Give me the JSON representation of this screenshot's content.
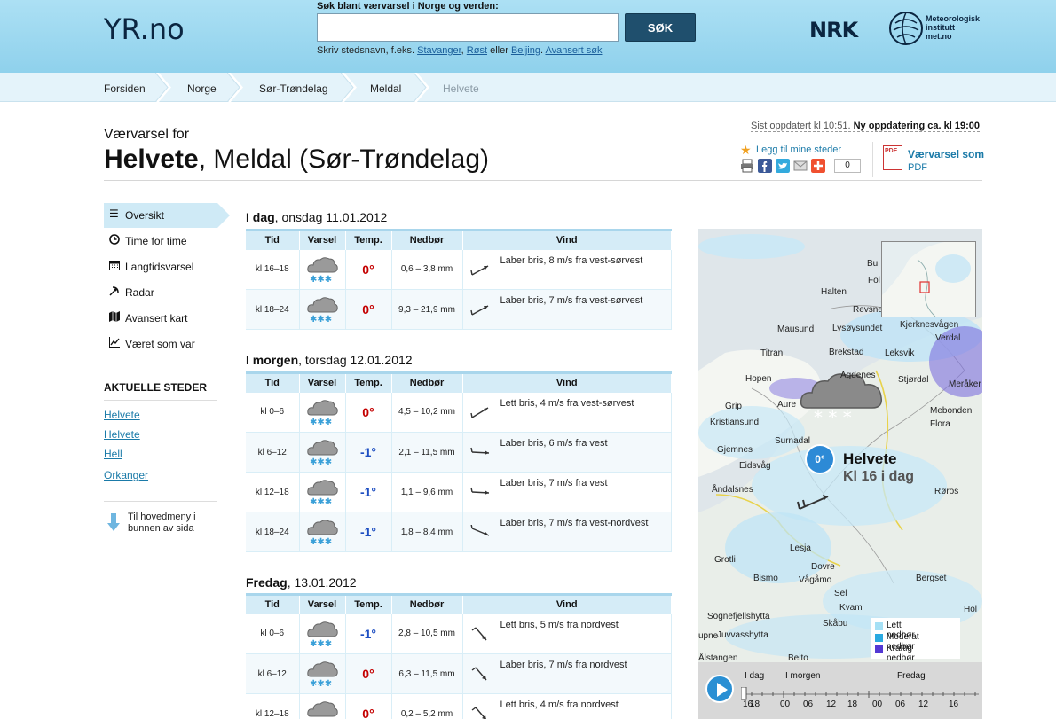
{
  "header": {
    "logo": "YR.no",
    "search_label": "Søk blant værvarsel i Norge og verden:",
    "search_value": "",
    "search_button": "SØK",
    "hint_prefix": "Skriv stedsnavn, f.eks.",
    "hint_links": [
      "Stavanger",
      "Røst",
      "Beijing"
    ],
    "hint_sep1": ",",
    "hint_sep2": "eller",
    "hint_advanced": "Avansert søk",
    "nrk": "NRK",
    "met_lines": [
      "Meteorologisk",
      "institutt",
      "met.no"
    ]
  },
  "breadcrumb": [
    "Forsiden",
    "Norge",
    "Sør-Trøndelag",
    "Meldal",
    "Helvete"
  ],
  "title": {
    "sub": "Værvarsel for",
    "place": "Helvete",
    "rest": ", Meldal (Sør-Trøndelag)"
  },
  "updated": {
    "last": "Sist oppdatert kl 10:51.",
    "next": "Ny oppdatering ca. kl 19:00"
  },
  "actions": {
    "favorite": "Legg til mine steder",
    "share_count": "0",
    "pdf_label": "Værvarsel som",
    "pdf_sub": "PDF"
  },
  "sidebar": {
    "items": [
      {
        "label": "Oversikt",
        "icon": "list-icon"
      },
      {
        "label": "Time for time",
        "icon": "clock-icon"
      },
      {
        "label": "Langtidsvarsel",
        "icon": "calendar-icon"
      },
      {
        "label": "Radar",
        "icon": "radar-icon"
      },
      {
        "label": "Avansert kart",
        "icon": "map-icon"
      },
      {
        "label": "Været som var",
        "icon": "chart-icon"
      }
    ],
    "aktuelle_title": "AKTUELLE STEDER",
    "places": [
      "Helvete",
      "Helvete",
      "Hell",
      "Orkanger"
    ],
    "to_menu": "Til hovedmeny i bunnen av sida"
  },
  "table_headers": [
    "Tid",
    "Varsel",
    "Temp.",
    "Nedbør",
    "Vind"
  ],
  "days": [
    {
      "title_bold": "I dag",
      "title_rest": ", onsdag 11.01.2012",
      "rows": [
        {
          "time": "kl 16–18",
          "temp": "0°",
          "temp_class": "pos",
          "precip": "0,6 – 3,8 mm",
          "wind": "Laber bris, 8 m/s fra vest-sørvest",
          "dir": "wsw"
        },
        {
          "time": "kl 18–24",
          "temp": "0°",
          "temp_class": "pos",
          "precip": "9,3 – 21,9 mm",
          "wind": "Laber bris, 7 m/s fra vest-sørvest",
          "dir": "wsw"
        }
      ]
    },
    {
      "title_bold": "I morgen",
      "title_rest": ", torsdag 12.01.2012",
      "rows": [
        {
          "time": "kl 0–6",
          "temp": "0°",
          "temp_class": "pos",
          "precip": "4,5 – 10,2 mm",
          "wind": "Lett bris, 4 m/s fra vest-sørvest",
          "dir": "sw"
        },
        {
          "time": "kl 6–12",
          "temp": "-1°",
          "temp_class": "neg",
          "precip": "2,1 – 11,5 mm",
          "wind": "Laber bris, 6 m/s fra vest",
          "dir": "w"
        },
        {
          "time": "kl 12–18",
          "temp": "-1°",
          "temp_class": "neg",
          "precip": "1,1 – 9,6 mm",
          "wind": "Laber bris, 7 m/s fra vest",
          "dir": "w"
        },
        {
          "time": "kl 18–24",
          "temp": "-1°",
          "temp_class": "neg",
          "precip": "1,8 – 8,4 mm",
          "wind": "Laber bris, 7 m/s fra vest-nordvest",
          "dir": "wnw"
        }
      ]
    },
    {
      "title_bold": "Fredag",
      "title_rest": ", 13.01.2012",
      "rows": [
        {
          "time": "kl 0–6",
          "temp": "-1°",
          "temp_class": "neg",
          "precip": "2,8 – 10,5 mm",
          "wind": "Lett bris, 5 m/s fra nordvest",
          "dir": "nw"
        },
        {
          "time": "kl 6–12",
          "temp": "0°",
          "temp_class": "pos",
          "precip": "6,3 – 11,5 mm",
          "wind": "Laber bris, 7 m/s fra nordvest",
          "dir": "nw"
        },
        {
          "time": "kl 12–18",
          "temp": "0°",
          "temp_class": "pos",
          "precip": "0,2 – 5,2 mm",
          "wind": "Lett bris, 4 m/s fra nordvest",
          "dir": "nw"
        }
      ]
    }
  ],
  "map": {
    "place_labels": [
      "Halten",
      "Mausund",
      "Lysøysundet",
      "Titran",
      "Brekstad",
      "Leksvik",
      "Hopen",
      "Agdenes",
      "Stjørdal",
      "Grip",
      "Aure",
      "Kristiansund",
      "Surnadal",
      "Gjemnes",
      "Eidsvåg",
      "Åndalsnes",
      "Røros",
      "Lesja",
      "Grotli",
      "Dovre",
      "Bismo",
      "Vågåmo",
      "Sel",
      "Kvam",
      "Skåbu",
      "Sognefjellshytta",
      "Juvvasshytta",
      "Ålstangen",
      "Beito",
      "Bergset",
      "Kjerknesvågen",
      "Verdal",
      "Mebonden",
      "Flora",
      "Meråker",
      "Revsnes",
      "Bu",
      "Fol",
      "Hol",
      "upne",
      "Åndalsnes"
    ],
    "big_place": "Helvete",
    "big_time": "Kl 16 i dag",
    "temp": "0°",
    "legend": [
      "Lett nedbør",
      "Moderat nedbør",
      "Kraftig nedbør"
    ],
    "legend_colors": [
      "#a5e0f5",
      "#2aa9e0",
      "#5338d4"
    ],
    "timeline_labels": [
      "I dag",
      "I morgen",
      "Fredag"
    ],
    "timeline_numbers": [
      "16",
      "18",
      "00",
      "06",
      "12",
      "18",
      "00",
      "06",
      "12",
      "16"
    ]
  }
}
